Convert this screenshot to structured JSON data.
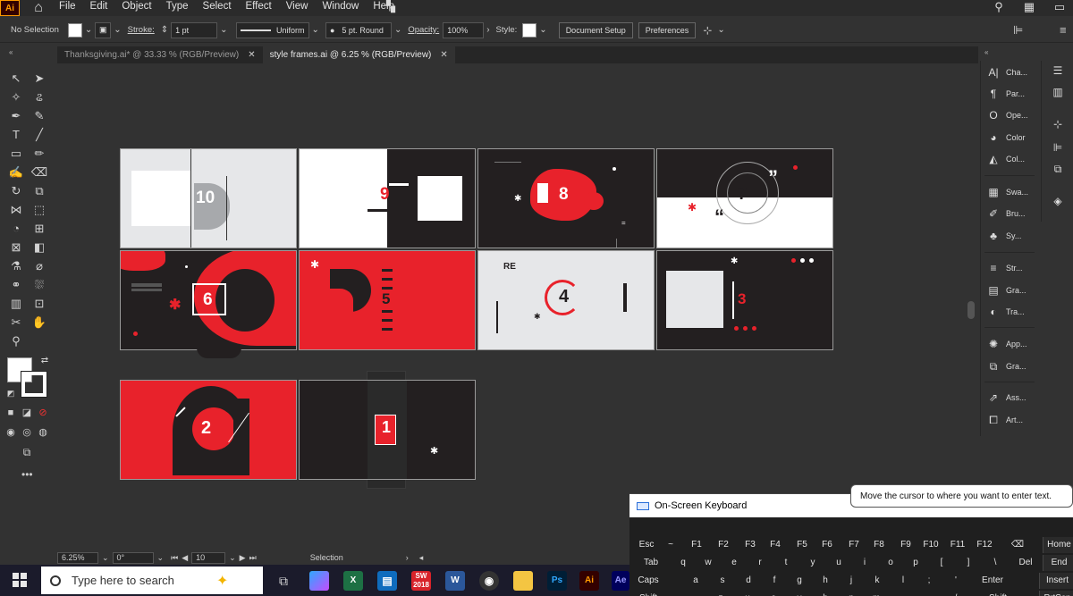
{
  "app": {
    "logo": "Ai",
    "menu": [
      "File",
      "Edit",
      "Object",
      "Type",
      "Select",
      "Effect",
      "View",
      "Window",
      "Help"
    ]
  },
  "control_bar": {
    "selection": "No Selection",
    "stroke_label": "Stroke:",
    "stroke_value": "1 pt",
    "stroke_profile": "Uniform",
    "brush": "5 pt. Round",
    "opacity_label": "Opacity:",
    "opacity_value": "100%",
    "style_label": "Style:",
    "document_setup": "Document Setup",
    "preferences": "Preferences"
  },
  "tabs": [
    {
      "label": "Thanksgiving.ai* @ 33.33 % (RGB/Preview)",
      "active": false
    },
    {
      "label": "style frames.ai @ 6.25 % (RGB/Preview)",
      "active": true
    }
  ],
  "artboards": {
    "numbers": [
      "10",
      "9",
      "8",
      "7",
      "6",
      "5",
      "4",
      "3",
      "2",
      "1"
    ],
    "text_re": "RE",
    "colors": {
      "red": "#e8222b",
      "dark": "#231f20",
      "light": "#e6e7e9",
      "white": "#ffffff"
    }
  },
  "panels": {
    "group1": [
      "Cha...",
      "Par...",
      "Ope...",
      "Color",
      "Col..."
    ],
    "group2": [
      "Swa...",
      "Bru...",
      "Sy..."
    ],
    "group3": [
      "Str...",
      "Gra...",
      "Tra..."
    ],
    "group4": [
      "App...",
      "Gra..."
    ],
    "group5": [
      "Ass...",
      "Art..."
    ]
  },
  "status_bar": {
    "zoom": "6.25%",
    "rotation": "0°",
    "artboard_num": "10",
    "tool": "Selection"
  },
  "osk": {
    "title": "On-Screen Keyboard",
    "tooltip": "Move the cursor to where you want to enter text.",
    "rows": [
      [
        "Esc",
        "~",
        "F1",
        "F2",
        "F3",
        "F4",
        "F5",
        "F6",
        "F7",
        "F8",
        "F9",
        "F10",
        "F11",
        "F12",
        "⌫",
        "Home"
      ],
      [
        "Tab",
        "q",
        "w",
        "e",
        "r",
        "t",
        "y",
        "u",
        "i",
        "o",
        "p",
        "[",
        "]",
        "\\",
        "Del",
        "End"
      ],
      [
        "Caps",
        "a",
        "s",
        "d",
        "f",
        "g",
        "h",
        "j",
        "k",
        "l",
        ";",
        "'",
        "Enter",
        "Insert"
      ],
      [
        "Shift",
        "z",
        "x",
        "c",
        "v",
        "b",
        "n",
        "m",
        ",",
        ".",
        "/",
        "Shift",
        "PrtScn"
      ]
    ]
  },
  "taskbar": {
    "search_placeholder": "Type here to search",
    "apps": [
      {
        "label": "X",
        "color": "#1d7044"
      },
      {
        "label": "W",
        "color": "#2b579a"
      },
      {
        "label": "Ps",
        "color": "#001e36"
      },
      {
        "label": "Ai",
        "color": "#330000"
      },
      {
        "label": "Ae",
        "color": "#00005b"
      }
    ],
    "sw_year": "2018"
  }
}
